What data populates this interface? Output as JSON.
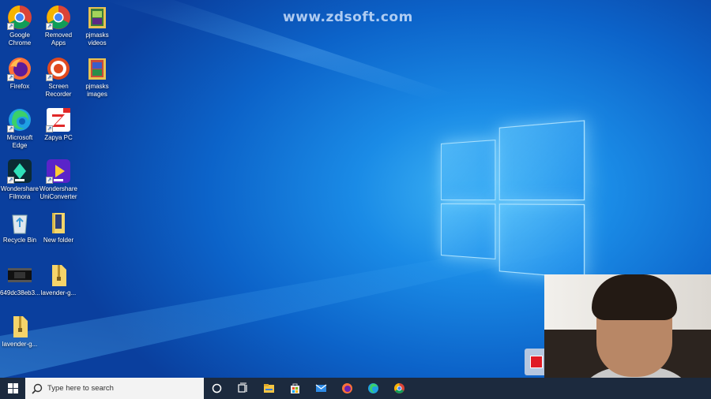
{
  "watermark": "www.zdsoft.com",
  "desktop_icons": [
    {
      "name": "Google Chrome",
      "line1": "Google",
      "line2": "Chrome",
      "icon": "chrome-icon"
    },
    {
      "name": "Removed Apps",
      "line1": "Removed",
      "line2": "Apps",
      "icon": "chrome-icon"
    },
    {
      "name": "pjmasks videos",
      "line1": "pjmasks",
      "line2": "videos",
      "icon": "folder-image-icon"
    },
    {
      "name": "Firefox",
      "line1": "Firefox",
      "line2": "",
      "icon": "firefox-icon"
    },
    {
      "name": "Screen Recorder",
      "line1": "Screen",
      "line2": "Recorder",
      "icon": "recorder-icon"
    },
    {
      "name": "pjmasks images",
      "line1": "pjmasks",
      "line2": "images",
      "icon": "folder-image-icon"
    },
    {
      "name": "Microsoft Edge",
      "line1": "Microsoft",
      "line2": "Edge",
      "icon": "edge-icon"
    },
    {
      "name": "Zapya PC",
      "line1": "Zapya PC",
      "line2": "",
      "icon": "zapya-icon"
    },
    {
      "name": "Wondershare Filmora",
      "line1": "Wondershare",
      "line2": "Filmora",
      "icon": "filmora-icon"
    },
    {
      "name": "Wondershare UniConverter",
      "line1": "Wondershare",
      "line2": "UniConverter",
      "icon": "uniconverter-icon"
    },
    {
      "name": "Recycle Bin",
      "line1": "Recycle Bin",
      "line2": "",
      "icon": "recycle-bin-icon"
    },
    {
      "name": "New folder",
      "line1": "New folder",
      "line2": "",
      "icon": "folder-icon"
    },
    {
      "name": "649dc38eb3...",
      "line1": "649dc38eb3...",
      "line2": "",
      "icon": "video-thumbnail-icon"
    },
    {
      "name": "lavender-g...",
      "line1": "lavender-g...",
      "line2": "",
      "icon": "zip-folder-icon"
    },
    {
      "name": "lavender-g...",
      "line1": "lavender-g...",
      "line2": "",
      "icon": "zip-folder-icon"
    }
  ],
  "taskbar": {
    "search_placeholder": "Type here to search",
    "items": [
      "start-icon",
      "cortana-icon",
      "task-view-icon",
      "file-explorer-icon",
      "store-icon",
      "mail-icon",
      "firefox-icon",
      "edge-icon",
      "chrome-icon"
    ]
  },
  "colors": {
    "taskbar": "#1c2a3e",
    "record_stop": "#e01b24",
    "desktop_accent": "#1a8be6"
  }
}
